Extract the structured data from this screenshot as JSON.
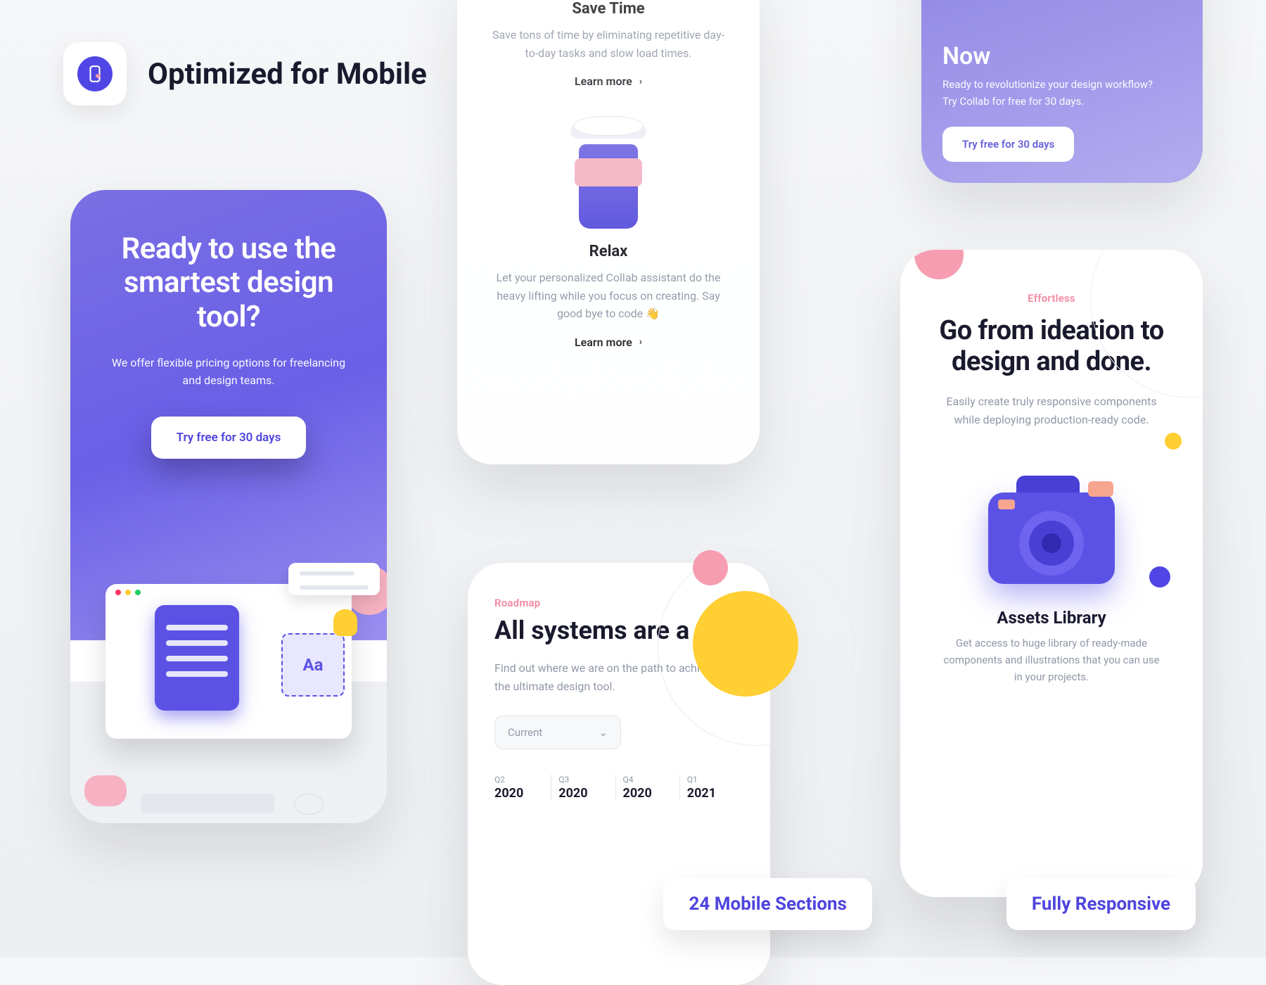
{
  "header": {
    "title": "Optimized for Mobile"
  },
  "card1": {
    "title": "Ready to use the smartest design tool?",
    "desc": "We offer flexible pricing options for freelancing and design teams.",
    "cta": "Try free for 30 days",
    "typo_label": "Aa"
  },
  "card2": {
    "sec1_title": "Save Time",
    "sec1_desc": "Save tons of time by eliminating repetitive day-to-day tasks and slow load times.",
    "learn_more": "Learn more",
    "sec2_title": "Relax",
    "sec2_desc": "Let your personalized Collab assistant do the heavy lifting while you focus on creating. Say good bye to code 👋"
  },
  "card3": {
    "title": "Now",
    "desc": "Ready to revolutionize your design workflow? Try Collab for free for 30 days.",
    "cta": "Try free for 30 days"
  },
  "card4": {
    "eyebrow": "Roadmap",
    "title": "All systems are a go",
    "desc": "Find out where we are on the path to achieving the ultimate design tool.",
    "dropdown": "Current",
    "timeline": [
      {
        "q": "Q2",
        "y": "2020"
      },
      {
        "q": "Q3",
        "y": "2020"
      },
      {
        "q": "Q4",
        "y": "2020"
      },
      {
        "q": "Q1",
        "y": "2021"
      }
    ]
  },
  "card5": {
    "eyebrow": "Effortless",
    "title": "Go from ideation to design and done.",
    "desc": "Easily create truly responsive components while deploying production-ready code.",
    "assets_title": "Assets Library",
    "assets_desc": "Get access to huge library of ready-made components and illustrations that you can use in your projects."
  },
  "pills": {
    "p1": "24 Mobile Sections",
    "p2": "Fully Responsive"
  },
  "colors": {
    "accent": "#5046E5",
    "yellow": "#ffcf33",
    "pink": "#f69db1"
  }
}
